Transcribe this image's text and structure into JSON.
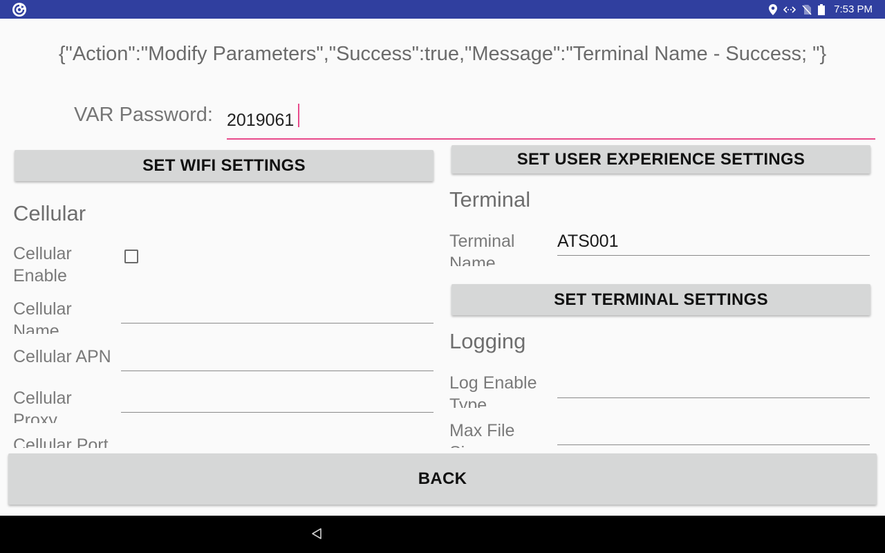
{
  "status_bar": {
    "time": "7:53 PM",
    "icons": [
      "location-icon",
      "data-sync-icon",
      "no-sim-icon",
      "battery-icon"
    ],
    "color": "#303f9f"
  },
  "response_text": "{\"Action\":\"Modify Parameters\",\"Success\":true,\"Message\":\"Terminal Name - Success; \"}",
  "var_password": {
    "label": "VAR Password:",
    "value": "2019061",
    "accent_color": "#e84a8b"
  },
  "buttons": {
    "wifi": "SET WIFI SETTINGS",
    "user_experience": "SET USER EXPERIENCE SETTINGS",
    "terminal": "SET TERMINAL SETTINGS",
    "back": "BACK"
  },
  "cellular": {
    "title": "Cellular",
    "enable_label": "Cellular Enable",
    "enable_checked": false,
    "name_label": "Cellular Name",
    "name_value": "",
    "apn_label": "Cellular APN",
    "apn_value": "",
    "proxy_label": "Cellular Proxy",
    "proxy_value": "",
    "port_label": "Cellular Port"
  },
  "terminal": {
    "title": "Terminal",
    "name_label": "Terminal Name",
    "name_value": "ATS001"
  },
  "logging": {
    "title": "Logging",
    "enable_type_label": "Log Enable Type",
    "enable_type_value": "",
    "max_file_label": "Max File Size",
    "max_file_value": ""
  }
}
